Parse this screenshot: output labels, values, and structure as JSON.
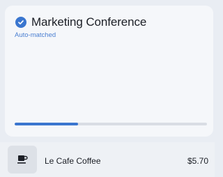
{
  "match_card": {
    "title": "Marketing Conference",
    "status": "Auto-matched",
    "progress": 0.33,
    "accent_color": "#3a76cf",
    "check_icon": "check-circle-icon"
  },
  "transaction": {
    "icon": "coffee-cup-icon",
    "merchant": "Le Cafe Coffee",
    "amount": "$5.70"
  }
}
